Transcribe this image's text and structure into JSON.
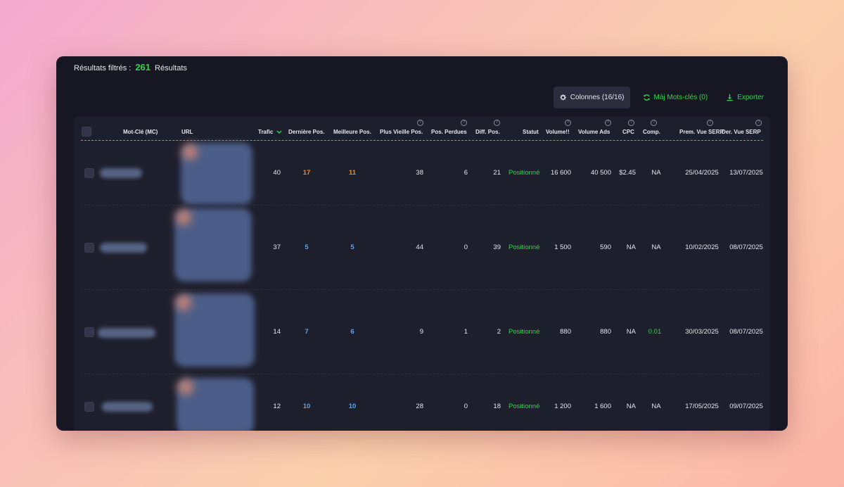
{
  "summary": {
    "label": "Résultats filtrés :",
    "count": "261",
    "suffix": "Résultats"
  },
  "toolbar": {
    "columns_label": "Colonnes (16/16)",
    "update_label": "Màj Mots-clés (0)",
    "export_label": "Exporter"
  },
  "colors": {
    "accent_green": "#2fd34a",
    "orange": "#f08a24",
    "blue": "#5aa3f0",
    "panel_bg": "#161722"
  },
  "table": {
    "headers": {
      "keyword": "Mot-Clé (MC)",
      "url": "URL",
      "trafic": "Trafic",
      "last_pos": "Dernière Pos.",
      "best_pos": "Meilleure Pos.",
      "oldest_pos": "Plus Vieille Pos.",
      "lost_pos": "Pos. Perdues",
      "diff_pos": "Diff. Pos.",
      "status": "Statut",
      "volume": "Volume!!",
      "volume_ads": "Volume Ads",
      "cpc": "CPC",
      "comp": "Comp.",
      "first_serp": "Prem. Vue SERP",
      "last_serp": "Der. Vue SERP"
    },
    "sort_icon": "chevron-down-icon",
    "help_icon": "question-circle-icon",
    "rows": [
      {
        "trafic": "40",
        "last_pos": "17",
        "best_pos": "11",
        "oldest_pos": "38",
        "lost_pos": "6",
        "diff_pos": "21",
        "status": "Positionné",
        "volume": "16 600",
        "volume_ads": "40 500",
        "cpc": "$2.45",
        "comp": "NA",
        "first_serp": "25/04/2025",
        "last_serp": "13/07/2025",
        "pos_color": "orange"
      },
      {
        "trafic": "37",
        "last_pos": "5",
        "best_pos": "5",
        "oldest_pos": "44",
        "lost_pos": "0",
        "diff_pos": "39",
        "status": "Positionné",
        "volume": "1 500",
        "volume_ads": "590",
        "cpc": "NA",
        "comp": "NA",
        "first_serp": "10/02/2025",
        "last_serp": "08/07/2025",
        "pos_color": "blue"
      },
      {
        "trafic": "14",
        "last_pos": "7",
        "best_pos": "6",
        "oldest_pos": "9",
        "lost_pos": "1",
        "diff_pos": "2",
        "status": "Positionné",
        "volume": "880",
        "volume_ads": "880",
        "cpc": "NA",
        "comp": "0.01",
        "first_serp": "30/03/2025",
        "last_serp": "08/07/2025",
        "pos_color": "blue"
      },
      {
        "trafic": "12",
        "last_pos": "10",
        "best_pos": "10",
        "oldest_pos": "28",
        "lost_pos": "0",
        "diff_pos": "18",
        "status": "Positionné",
        "volume": "1 200",
        "volume_ads": "1 600",
        "cpc": "NA",
        "comp": "NA",
        "first_serp": "17/05/2025",
        "last_serp": "09/07/2025",
        "pos_color": "blue"
      }
    ]
  }
}
